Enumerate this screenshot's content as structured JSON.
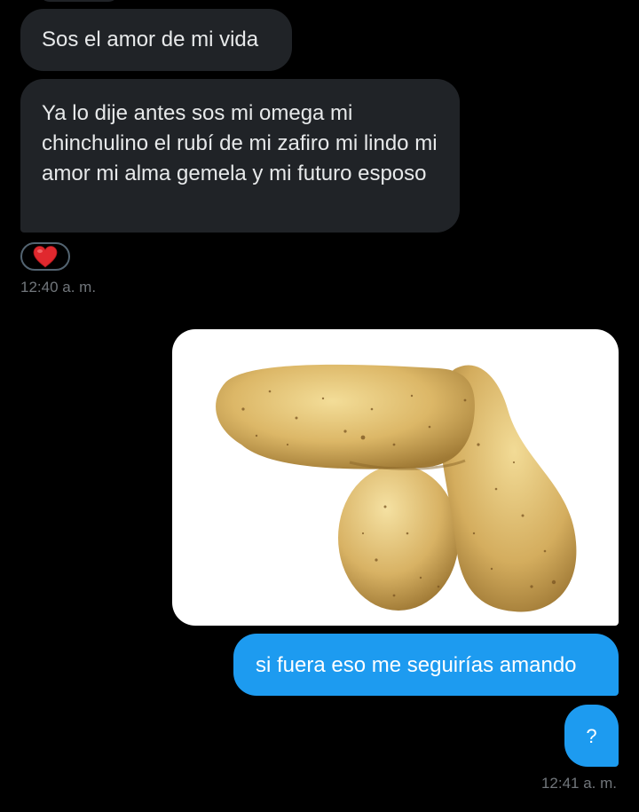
{
  "conversation": {
    "messages": [
      {
        "direction": "incoming",
        "text": "Sos el amor de mi vida"
      },
      {
        "direction": "incoming",
        "text": "Ya lo dije antes sos mi omega mi chinchulino el rubí de mi zafiro mi lindo mi amor mi alma gemela y mi futuro esposo"
      },
      {
        "direction": "outgoing",
        "text": "si fuera eso me seguirías amando"
      },
      {
        "direction": "outgoing",
        "text": "?"
      }
    ],
    "reaction": {
      "emoji": "heart-icon"
    },
    "timestamps": {
      "incoming": "12:40 a. m.",
      "outgoing": "12:41 a. m."
    },
    "media": {
      "icon": "potato-image"
    }
  },
  "colors": {
    "background": "#000000",
    "incoming_bubble": "#202327",
    "outgoing_bubble": "#1d9bf0",
    "timestamp": "#71767b",
    "heart": "#f91880"
  }
}
